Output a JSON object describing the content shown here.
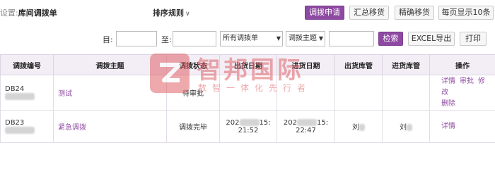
{
  "header": {
    "breadcrumb_prefix": "设置:",
    "breadcrumb_current": "库间调拨单",
    "sort_label": "排序规则",
    "buttons": {
      "transfer_request": "调拨申请",
      "summary_transfer": "汇总移货",
      "precise_transfer": "精确移货",
      "per_page": "每页显示10条"
    }
  },
  "filters": {
    "date_from_label": "目:",
    "date_to_label": "至:",
    "type_select": "所有调拨单",
    "field_select": "调拨主题",
    "search_button": "检索",
    "excel_button": "EXCEL导出",
    "print_button": "打印"
  },
  "table": {
    "columns": [
      "调拨编号",
      "调拨主题",
      "调拨状态",
      "出货日期",
      "进货日期",
      "出货库管",
      "进货库管",
      "操作"
    ],
    "rows": [
      {
        "id": "DB24",
        "subject": "测试",
        "status": "待审批",
        "out_date": "",
        "in_date": "",
        "out_keeper": "",
        "in_keeper": "",
        "actions": [
          "详情",
          "审批",
          "修改",
          "删除"
        ]
      },
      {
        "id": "DB23",
        "subject": "紧急调拨",
        "status": "调拨完毕",
        "out_date_a": "202",
        "out_date_b": "15:",
        "out_time": "21:52",
        "in_date_a": "202",
        "in_date_b": "15:",
        "in_time": "22:47",
        "out_keeper": "刘",
        "in_keeper": "刘",
        "actions": [
          "详情"
        ]
      }
    ]
  },
  "watermark": {
    "title": "智邦国际",
    "subtitle": "数智一体化先行者"
  },
  "colors": {
    "accent": "#8e4aa2",
    "watermark": "#e0636a",
    "header_bg": "#f3eef6"
  }
}
